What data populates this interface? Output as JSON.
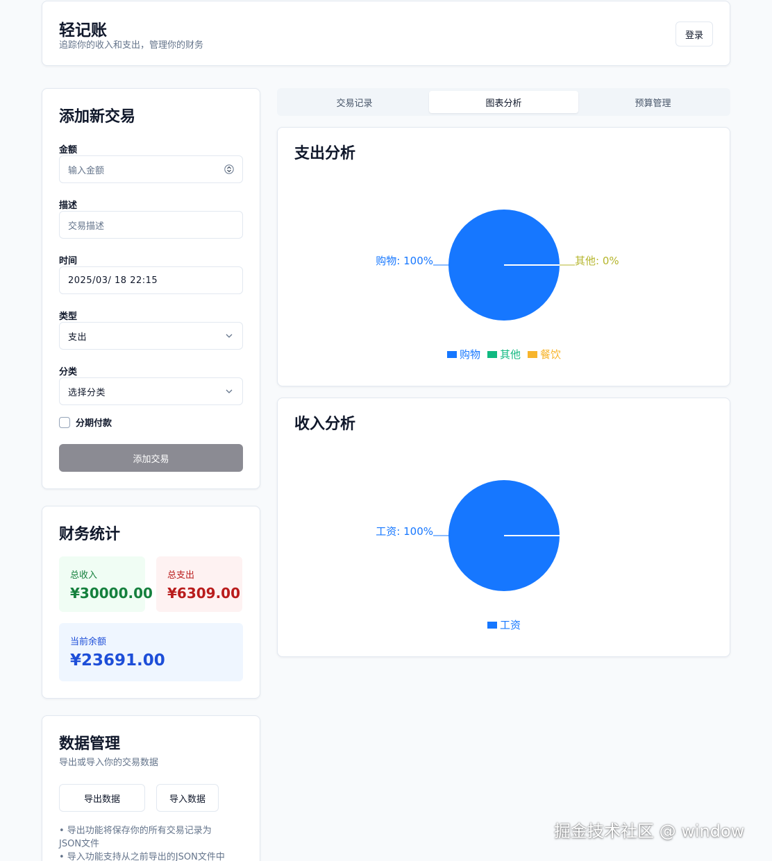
{
  "header": {
    "title": "轻记账",
    "subtitle": "追踪你的收入和支出，管理你的财务",
    "login_label": "登录"
  },
  "form": {
    "heading": "添加新交易",
    "amount": {
      "label": "金额",
      "placeholder": "输入金额"
    },
    "description": {
      "label": "描述",
      "placeholder": "交易描述"
    },
    "time": {
      "label": "时间",
      "value": "2025/03/ 18 22:15"
    },
    "type": {
      "label": "类型",
      "value": "支出"
    },
    "category": {
      "label": "分类",
      "value": "选择分类"
    },
    "installment_label": "分期付款",
    "submit_label": "添加交易"
  },
  "stats": {
    "heading": "财务统计",
    "income_label": "总收入",
    "income_value": "¥30000.00",
    "expense_label": "总支出",
    "expense_value": "¥6309.00",
    "balance_label": "当前余额",
    "balance_value": "¥23691.00"
  },
  "data_management": {
    "heading": "数据管理",
    "subtitle": "导出或导入你的交易数据",
    "export_label": "导出数据",
    "import_label": "导入数据",
    "notes": [
      "• 导出功能将保存你的所有交易记录为JSON文件",
      "• 导入功能支持从之前导出的JSON文件中"
    ]
  },
  "tabs": [
    {
      "label": "交易记录",
      "active": false
    },
    {
      "label": "图表分析",
      "active": true
    },
    {
      "label": "预算管理",
      "active": false
    }
  ],
  "colors": {
    "shopping": "#1677ff",
    "other": "#10b981",
    "food": "#f7b52c",
    "other_label": "#b5b52c"
  },
  "chart_data": [
    {
      "type": "pie",
      "title": "支出分析",
      "slices": [
        {
          "label": "购物",
          "value": 100,
          "color": "#1677ff"
        },
        {
          "label": "其他",
          "value": 0,
          "color": "#10b981"
        }
      ],
      "slice_labels": [
        {
          "text": "购物: 100%",
          "color": "#1677ff"
        },
        {
          "text": "其他: 0%",
          "color": "#b5b52c"
        }
      ],
      "legend": [
        {
          "label": "购物",
          "color": "#1677ff"
        },
        {
          "label": "其他",
          "color": "#10b981"
        },
        {
          "label": "餐饮",
          "color": "#f7b52c"
        }
      ],
      "legend_position": "bottom"
    },
    {
      "type": "pie",
      "title": "收入分析",
      "slices": [
        {
          "label": "工资",
          "value": 100,
          "color": "#1677ff"
        }
      ],
      "slice_labels": [
        {
          "text": "工资: 100%",
          "color": "#1677ff"
        }
      ],
      "legend": [
        {
          "label": "工资",
          "color": "#1677ff"
        }
      ],
      "legend_position": "bottom"
    }
  ],
  "watermark": "掘金技术社区 @ window"
}
